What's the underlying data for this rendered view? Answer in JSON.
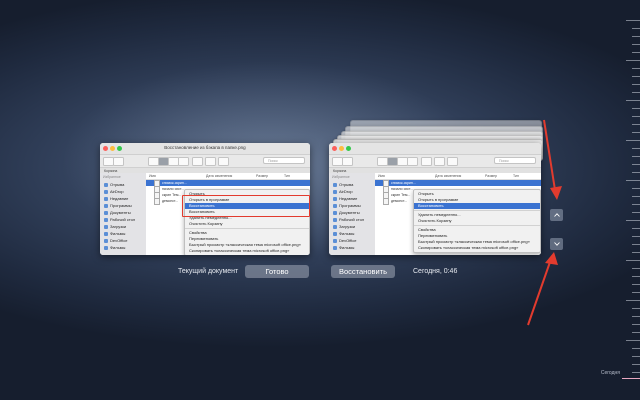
{
  "left_window": {
    "title": "Восстановление из бэкапа в папке.png",
    "path": "Корзина",
    "search_placeholder": "Поиск",
    "sidebar_heading": "Избранное",
    "sidebar": [
      "Отрыва",
      "AirDrop",
      "Недавние",
      "Программы",
      "Документы",
      "Рабочий стол",
      "Загрузки",
      "Фильмы",
      "DevOffice",
      "Фильмы"
    ],
    "columns": {
      "name": "Имя",
      "date": "Дата изменения",
      "size": "Размер",
      "kind": "Тип"
    },
    "files": [
      "снимок-скрин...",
      "начало сист...",
      "скрин Тем...",
      "демонст..."
    ],
    "context": {
      "open": "Открыть",
      "open_with": "Открыть в программе",
      "recover": "Восстановить",
      "recover2": "Восстановить",
      "delete_now": "Удалить немедленно...",
      "empty_trash": "Очистить Корзину",
      "props": "Свойства",
      "rename": "Переименовать",
      "quick_look": "Быстрый просмотр «классическая тема microsoft office.png»",
      "copy": "Скопировать «классическая тема microsoft office.png»"
    }
  },
  "right_window": {
    "path": "Корзина",
    "search_placeholder": "Поиск",
    "sidebar_heading": "Избранное",
    "sidebar": [
      "Отрыва",
      "AirDrop",
      "Недавние",
      "Программы",
      "Документы",
      "Рабочий стол",
      "Загрузки",
      "Фильмы",
      "DevOffice",
      "Фильмы"
    ],
    "columns": {
      "name": "Имя",
      "date": "Дата изменения",
      "size": "Размер",
      "kind": "Тип"
    },
    "files": [
      "снимок-скрин...",
      "начало сист...",
      "скрин Тем...",
      "демонст..."
    ],
    "context": {
      "open": "Открыть",
      "open_with": "Открыть в программе",
      "recover": "Восстановить",
      "delete_now": "Удалить немедленно...",
      "empty_trash": "Очистить Корзину",
      "props": "Свойства",
      "rename": "Переименовать",
      "quick_look": "Быстрый просмотр «классическая тема microsoft office.png»",
      "copy": "Скопировать «классическая тема microsoft office.png»"
    }
  },
  "bottom": {
    "current_doc": "Текущий документ",
    "done": "Готово",
    "restore": "Восстановить",
    "snapshot_time": "Сегодня, 0:46"
  },
  "timeline": {
    "label": "Сегодня"
  },
  "colors": {
    "accent": "#3b73d1",
    "arrow": "#e23b2e"
  }
}
